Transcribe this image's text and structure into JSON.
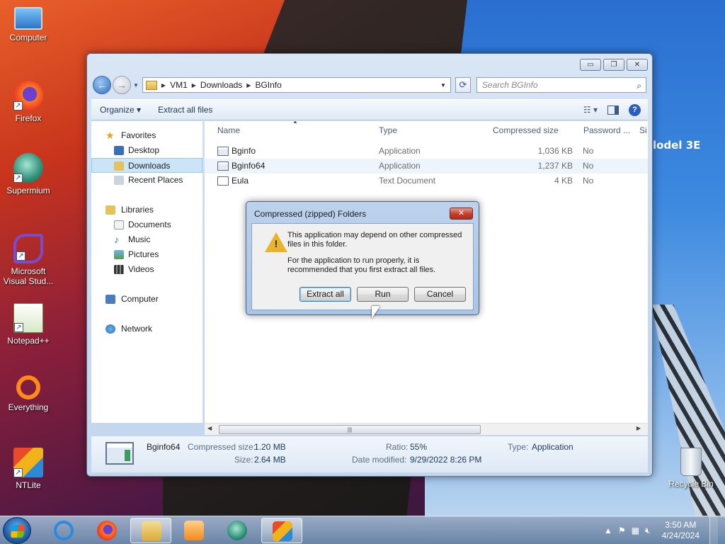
{
  "desktop": {
    "icons": [
      {
        "label": "Computer",
        "icon": "computer-icon"
      },
      {
        "label": "Firefox",
        "icon": "firefox-icon"
      },
      {
        "label": "Supermium",
        "icon": "supermium-icon"
      },
      {
        "label": "Microsoft Visual Stud...",
        "icon": "visual-studio-icon"
      },
      {
        "label": "Notepad++",
        "icon": "notepadpp-icon"
      },
      {
        "label": "Everything",
        "icon": "everything-icon"
      },
      {
        "label": "NTLite",
        "icon": "ntlite-icon"
      },
      {
        "label": "Recycle Bin",
        "icon": "recycle-bin-icon"
      }
    ],
    "wallpaper_text": "lodel 3E"
  },
  "explorer": {
    "caption_buttons": {
      "minimize": "▭",
      "maximize": "❐",
      "close": "✕"
    },
    "address": {
      "crumbs": [
        "VM1",
        "Downloads",
        "BGInfo"
      ]
    },
    "search": {
      "placeholder": "Search BGInfo"
    },
    "toolbar": {
      "organize": "Organize ▾",
      "extract_all": "Extract all files",
      "view": "☷ ▾",
      "help": "?"
    },
    "nav": {
      "favorites": "Favorites",
      "desktop": "Desktop",
      "downloads": "Downloads",
      "recent_places": "Recent Places",
      "libraries": "Libraries",
      "documents": "Documents",
      "music": "Music",
      "pictures": "Pictures",
      "videos": "Videos",
      "computer": "Computer",
      "network": "Network"
    },
    "columns": {
      "name": "Name",
      "type": "Type",
      "compressed_size": "Compressed size",
      "password": "Password ...",
      "extra": "Si"
    },
    "files": [
      {
        "name": "Bginfo",
        "type": "Application",
        "compressed_size": "1,036 KB",
        "password": "No"
      },
      {
        "name": "Bginfo64",
        "type": "Application",
        "compressed_size": "1,237 KB",
        "password": "No"
      },
      {
        "name": "Eula",
        "type": "Text Document",
        "compressed_size": "4 KB",
        "password": "No"
      }
    ],
    "details": {
      "name": "Bginfo64",
      "compressed_size_label": "Compressed size:",
      "compressed_size": "1.20 MB",
      "size_label": "Size:",
      "size": "2.64 MB",
      "ratio_label": "Ratio:",
      "ratio": "55%",
      "date_label": "Date modified:",
      "date": "9/29/2022 8:26 PM",
      "type_label": "Type:",
      "type": "Application"
    }
  },
  "dialog": {
    "title": "Compressed (zipped) Folders",
    "message1": "This application may depend on other compressed files in this folder.",
    "message2": "For the application to run properly, it is recommended that you first extract all files.",
    "buttons": {
      "extract_all": "Extract all",
      "run": "Run",
      "cancel": "Cancel"
    }
  },
  "taskbar": {
    "pinned": [
      "internet-explorer-icon",
      "firefox-icon",
      "file-explorer-icon",
      "media-player-icon",
      "supermium-icon",
      "ntlite-icon"
    ],
    "clock_time": "3:50 AM",
    "clock_date": "4/24/2024"
  }
}
